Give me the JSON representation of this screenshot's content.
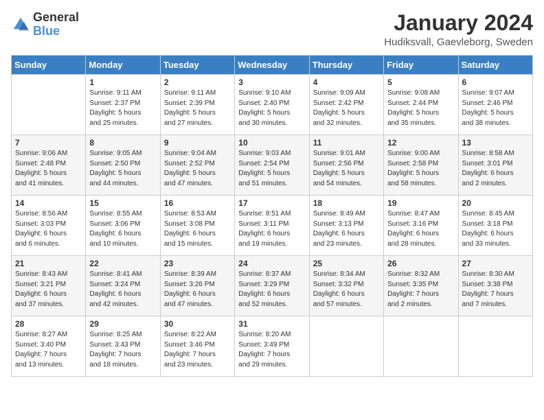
{
  "header": {
    "logo": {
      "general": "General",
      "blue": "Blue"
    },
    "title": "January 2024",
    "location": "Hudiksvall, Gaevleborg, Sweden"
  },
  "weekdays": [
    "Sunday",
    "Monday",
    "Tuesday",
    "Wednesday",
    "Thursday",
    "Friday",
    "Saturday"
  ],
  "weeks": [
    [
      {
        "day": "",
        "info": ""
      },
      {
        "day": "1",
        "info": "Sunrise: 9:11 AM\nSunset: 2:37 PM\nDaylight: 5 hours\nand 25 minutes."
      },
      {
        "day": "2",
        "info": "Sunrise: 9:11 AM\nSunset: 2:39 PM\nDaylight: 5 hours\nand 27 minutes."
      },
      {
        "day": "3",
        "info": "Sunrise: 9:10 AM\nSunset: 2:40 PM\nDaylight: 5 hours\nand 30 minutes."
      },
      {
        "day": "4",
        "info": "Sunrise: 9:09 AM\nSunset: 2:42 PM\nDaylight: 5 hours\nand 32 minutes."
      },
      {
        "day": "5",
        "info": "Sunrise: 9:08 AM\nSunset: 2:44 PM\nDaylight: 5 hours\nand 35 minutes."
      },
      {
        "day": "6",
        "info": "Sunrise: 9:07 AM\nSunset: 2:46 PM\nDaylight: 5 hours\nand 38 minutes."
      }
    ],
    [
      {
        "day": "7",
        "info": "Sunrise: 9:06 AM\nSunset: 2:48 PM\nDaylight: 5 hours\nand 41 minutes."
      },
      {
        "day": "8",
        "info": "Sunrise: 9:05 AM\nSunset: 2:50 PM\nDaylight: 5 hours\nand 44 minutes."
      },
      {
        "day": "9",
        "info": "Sunrise: 9:04 AM\nSunset: 2:52 PM\nDaylight: 5 hours\nand 47 minutes."
      },
      {
        "day": "10",
        "info": "Sunrise: 9:03 AM\nSunset: 2:54 PM\nDaylight: 5 hours\nand 51 minutes."
      },
      {
        "day": "11",
        "info": "Sunrise: 9:01 AM\nSunset: 2:56 PM\nDaylight: 5 hours\nand 54 minutes."
      },
      {
        "day": "12",
        "info": "Sunrise: 9:00 AM\nSunset: 2:58 PM\nDaylight: 5 hours\nand 58 minutes."
      },
      {
        "day": "13",
        "info": "Sunrise: 8:58 AM\nSunset: 3:01 PM\nDaylight: 6 hours\nand 2 minutes."
      }
    ],
    [
      {
        "day": "14",
        "info": "Sunrise: 8:56 AM\nSunset: 3:03 PM\nDaylight: 6 hours\nand 6 minutes."
      },
      {
        "day": "15",
        "info": "Sunrise: 8:55 AM\nSunset: 3:06 PM\nDaylight: 6 hours\nand 10 minutes."
      },
      {
        "day": "16",
        "info": "Sunrise: 8:53 AM\nSunset: 3:08 PM\nDaylight: 6 hours\nand 15 minutes."
      },
      {
        "day": "17",
        "info": "Sunrise: 8:51 AM\nSunset: 3:11 PM\nDaylight: 6 hours\nand 19 minutes."
      },
      {
        "day": "18",
        "info": "Sunrise: 8:49 AM\nSunset: 3:13 PM\nDaylight: 6 hours\nand 23 minutes."
      },
      {
        "day": "19",
        "info": "Sunrise: 8:47 AM\nSunset: 3:16 PM\nDaylight: 6 hours\nand 28 minutes."
      },
      {
        "day": "20",
        "info": "Sunrise: 8:45 AM\nSunset: 3:18 PM\nDaylight: 6 hours\nand 33 minutes."
      }
    ],
    [
      {
        "day": "21",
        "info": "Sunrise: 8:43 AM\nSunset: 3:21 PM\nDaylight: 6 hours\nand 37 minutes."
      },
      {
        "day": "22",
        "info": "Sunrise: 8:41 AM\nSunset: 3:24 PM\nDaylight: 6 hours\nand 42 minutes."
      },
      {
        "day": "23",
        "info": "Sunrise: 8:39 AM\nSunset: 3:26 PM\nDaylight: 6 hours\nand 47 minutes."
      },
      {
        "day": "24",
        "info": "Sunrise: 8:37 AM\nSunset: 3:29 PM\nDaylight: 6 hours\nand 52 minutes."
      },
      {
        "day": "25",
        "info": "Sunrise: 8:34 AM\nSunset: 3:32 PM\nDaylight: 6 hours\nand 57 minutes."
      },
      {
        "day": "26",
        "info": "Sunrise: 8:32 AM\nSunset: 3:35 PM\nDaylight: 7 hours\nand 2 minutes."
      },
      {
        "day": "27",
        "info": "Sunrise: 8:30 AM\nSunset: 3:38 PM\nDaylight: 7 hours\nand 7 minutes."
      }
    ],
    [
      {
        "day": "28",
        "info": "Sunrise: 8:27 AM\nSunset: 3:40 PM\nDaylight: 7 hours\nand 13 minutes."
      },
      {
        "day": "29",
        "info": "Sunrise: 8:25 AM\nSunset: 3:43 PM\nDaylight: 7 hours\nand 18 minutes."
      },
      {
        "day": "30",
        "info": "Sunrise: 8:22 AM\nSunset: 3:46 PM\nDaylight: 7 hours\nand 23 minutes."
      },
      {
        "day": "31",
        "info": "Sunrise: 8:20 AM\nSunset: 3:49 PM\nDaylight: 7 hours\nand 29 minutes."
      },
      {
        "day": "",
        "info": ""
      },
      {
        "day": "",
        "info": ""
      },
      {
        "day": "",
        "info": ""
      }
    ]
  ]
}
